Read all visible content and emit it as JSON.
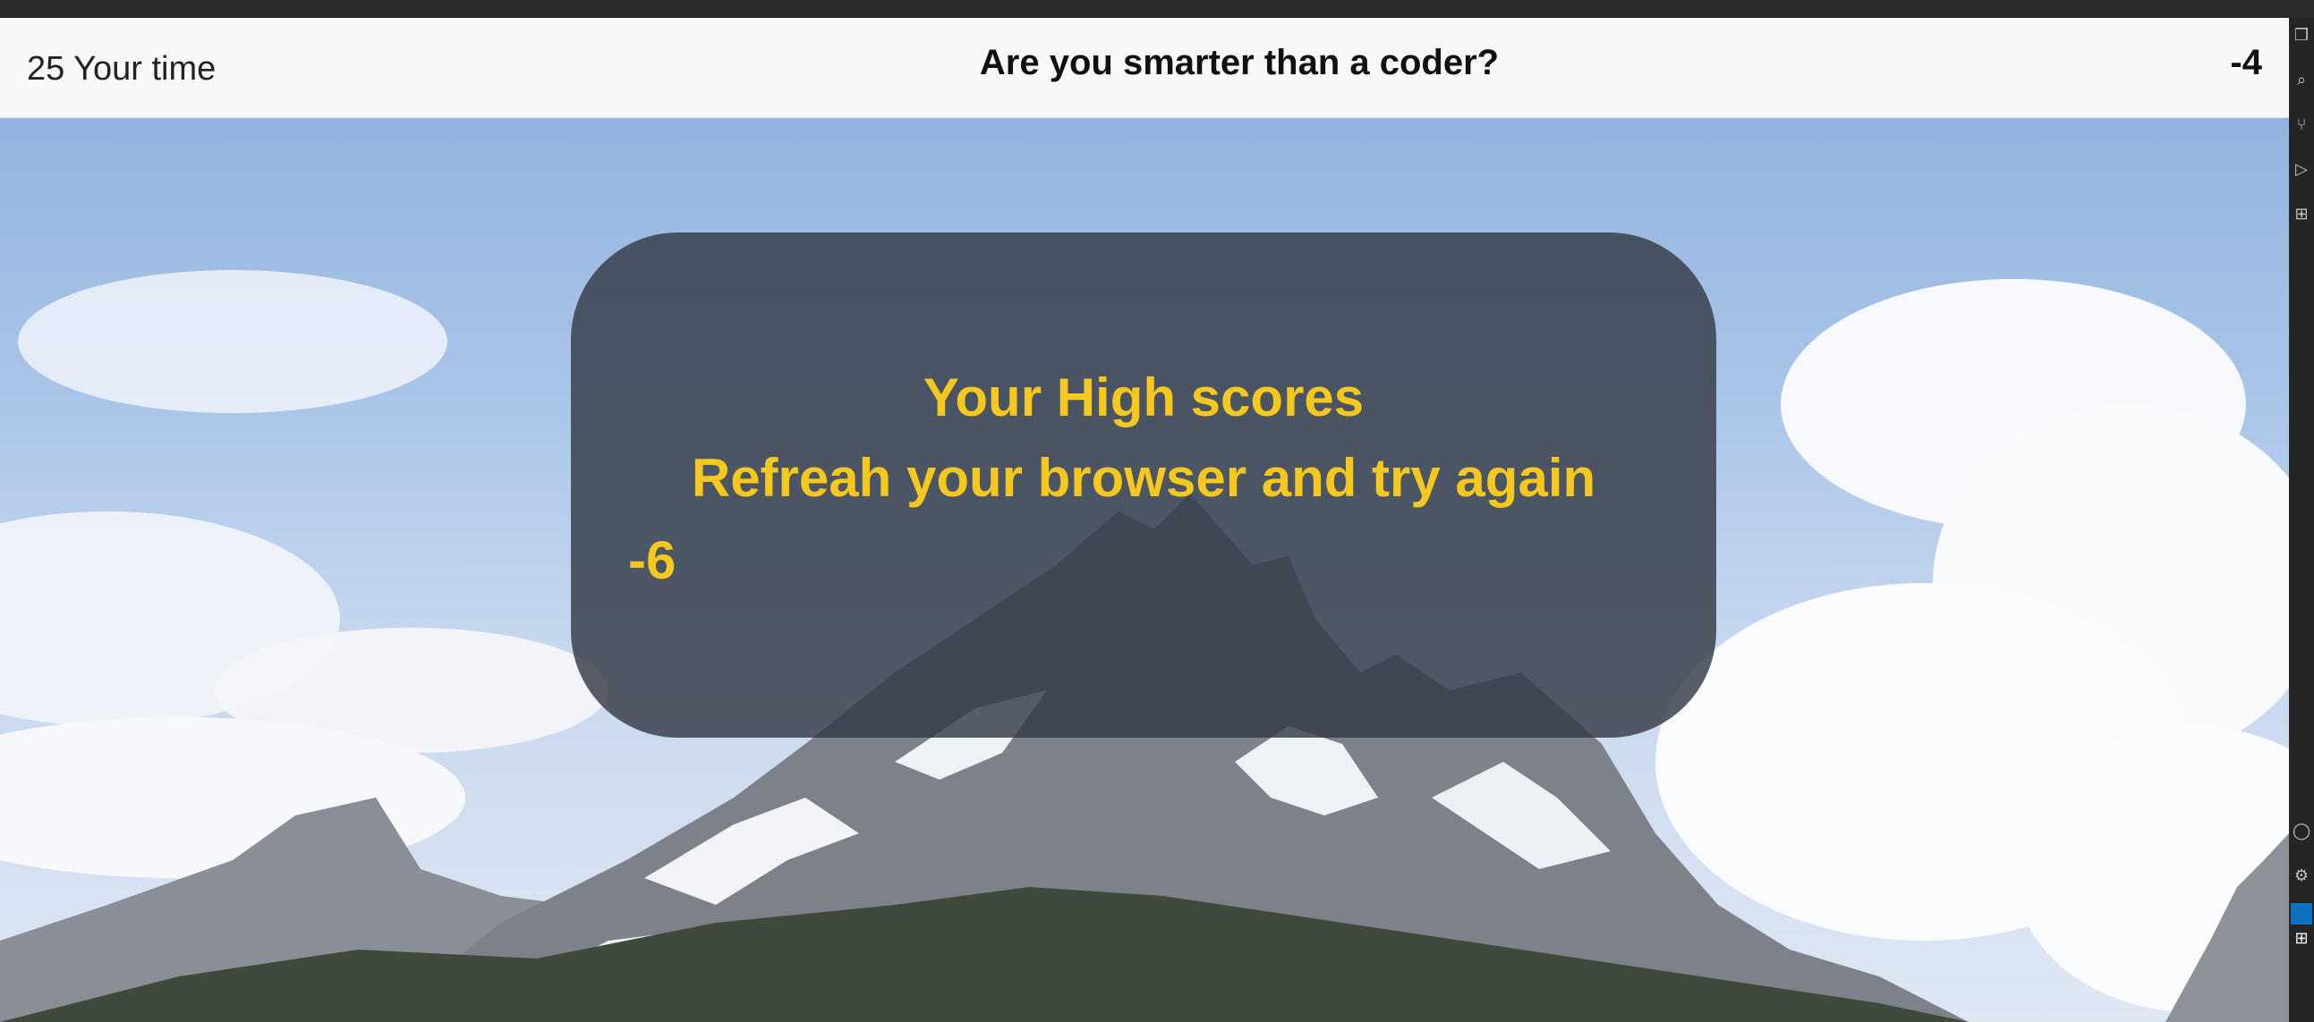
{
  "header": {
    "timer_text": "25 Your time",
    "title": "Are you smarter than a coder?",
    "score": "-4"
  },
  "modal": {
    "heading": "Your High scores",
    "message": "Refreah your browser and try again",
    "result": "-6"
  },
  "activity_bar": {
    "icons": [
      "explorer-icon",
      "search-icon",
      "source-control-icon",
      "run-debug-icon",
      "extensions-icon",
      "account-icon",
      "settings-gear-icon",
      "remote-icon",
      "windows-icon"
    ]
  },
  "colors": {
    "accent_text": "#f4c81f",
    "modal_bg": "#343a46",
    "header_bg": "#f7f8fa",
    "activity_bar_bg": "#252526"
  }
}
